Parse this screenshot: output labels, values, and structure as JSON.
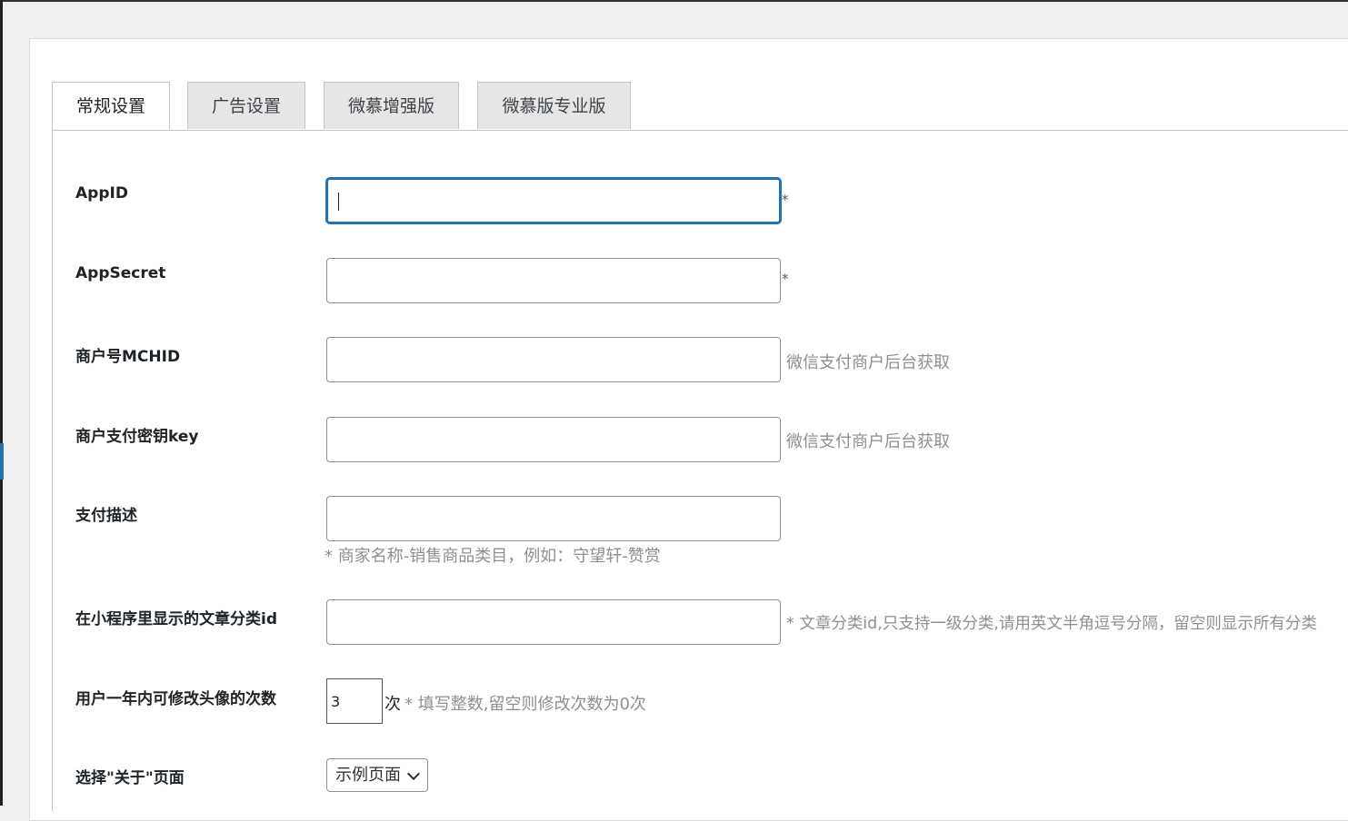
{
  "tabs": [
    {
      "label": "常规设置",
      "active": true
    },
    {
      "label": "广告设置",
      "active": false
    },
    {
      "label": "微慕增强版",
      "active": false
    },
    {
      "label": "微慕版专业版",
      "active": false
    }
  ],
  "fields": {
    "appid": {
      "label": "AppID",
      "value": "",
      "required_mark": "*"
    },
    "appsecret": {
      "label": "AppSecret",
      "value": "",
      "required_mark": "*"
    },
    "mchid": {
      "label": "商户号MCHID",
      "value": "",
      "hint": "微信支付商户后台获取"
    },
    "paykey": {
      "label": "商户支付密钥key",
      "value": "",
      "hint": "微信支付商户后台获取"
    },
    "paydesc": {
      "label": "支付描述",
      "value": "",
      "hint": "* 商家名称-销售商品类目，例如：守望轩-赞赏"
    },
    "category_ids": {
      "label": "在小程序里显示的文章分类id",
      "value": "",
      "hint": "* 文章分类id,只支持一级分类,请用英文半角逗号分隔，留空则显示所有分类"
    },
    "avatar_limit": {
      "label": "用户一年内可修改头像的次数",
      "value": "3",
      "unit": "次",
      "hint": "* 填写整数,留空则修改次数为0次"
    },
    "about_page": {
      "label": "选择\"关于\"页面",
      "selected": "示例页面"
    }
  },
  "colors": {
    "focus": "#2271b1",
    "hint": "#8c8f94"
  }
}
